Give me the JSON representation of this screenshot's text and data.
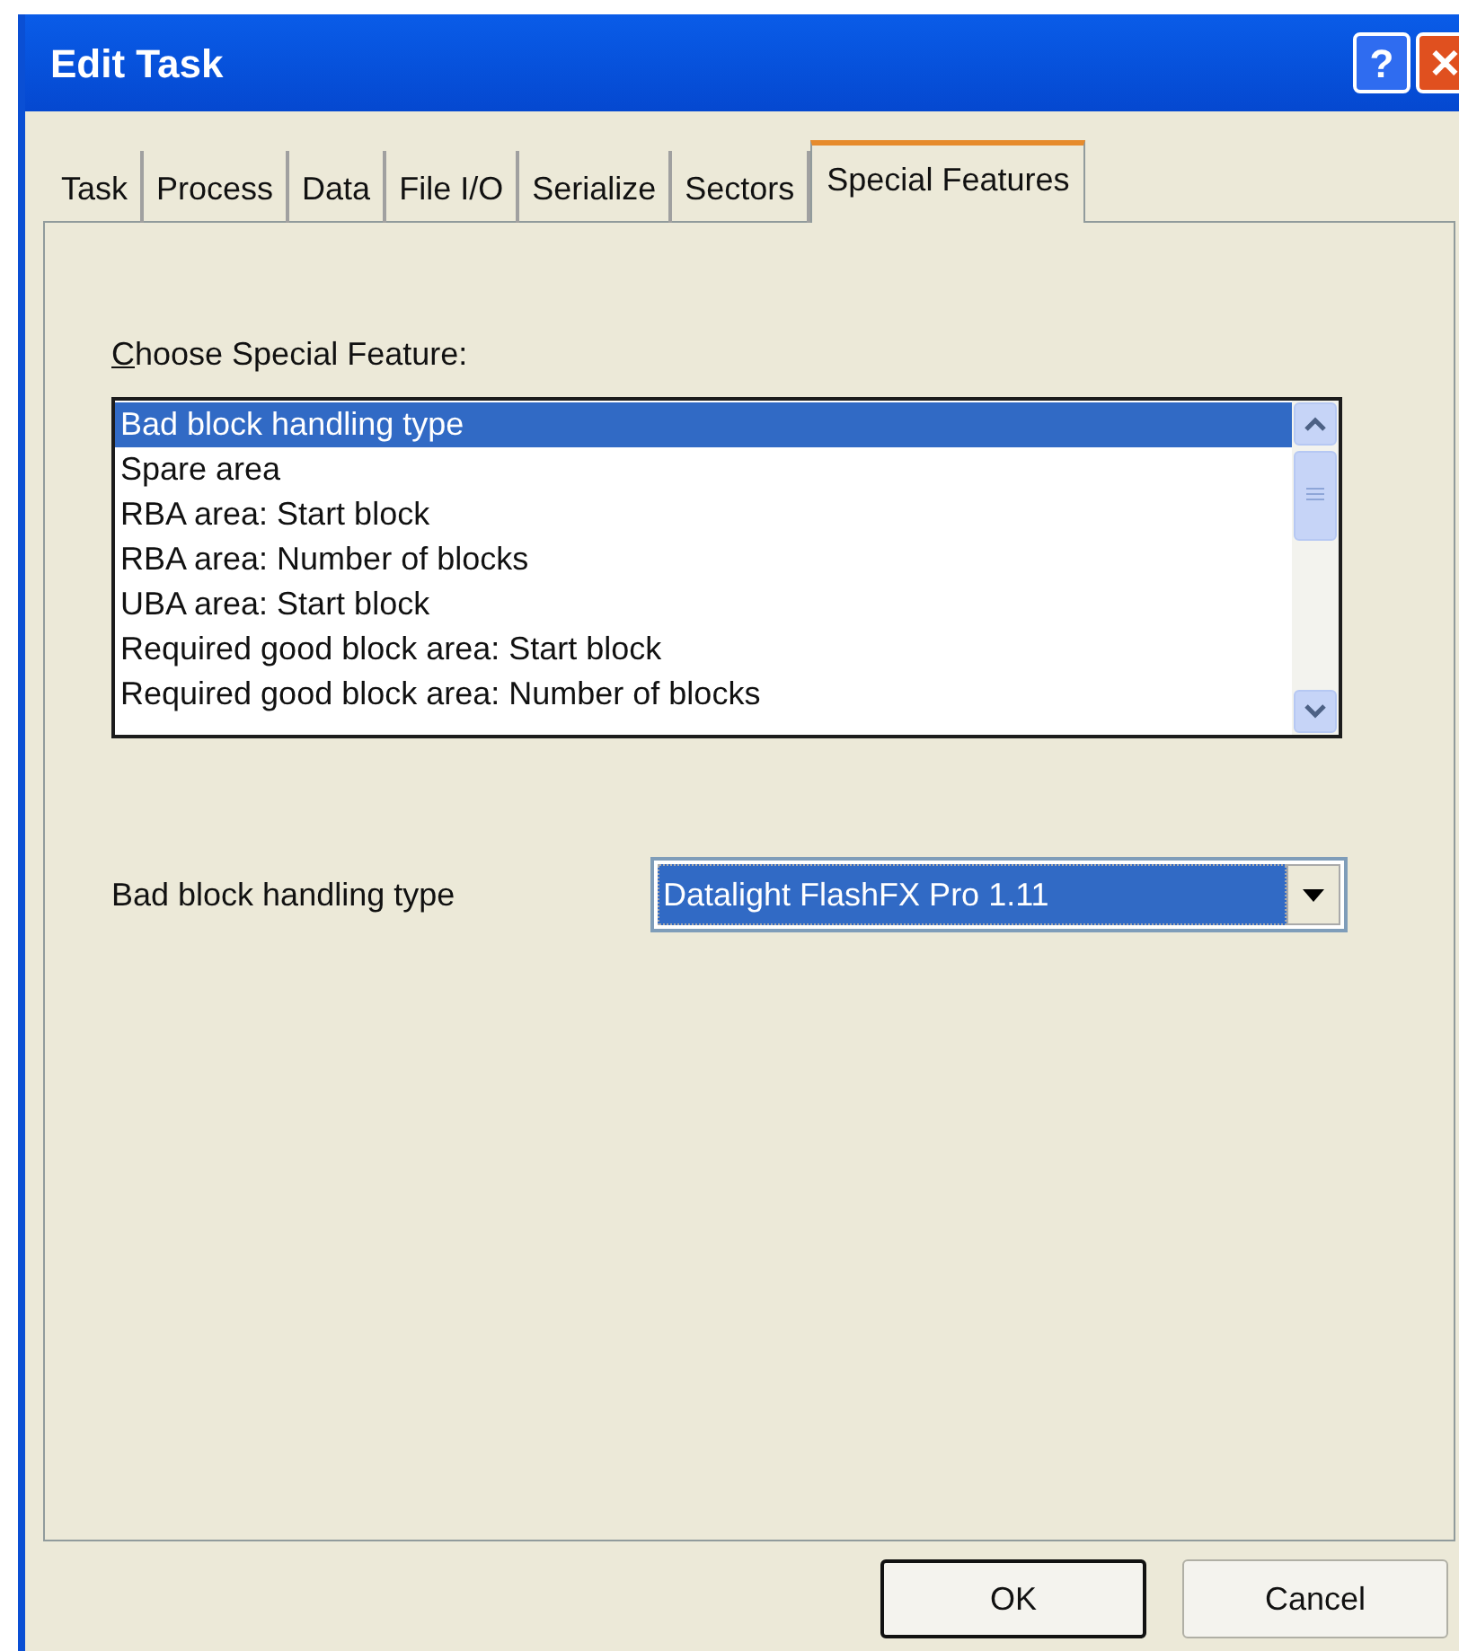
{
  "window": {
    "title": "Edit Task",
    "title_buttons": [
      {
        "kind": "help",
        "label": "?"
      },
      {
        "kind": "close",
        "label": "✕"
      }
    ]
  },
  "tabs": [
    {
      "label": "Task",
      "selected": false
    },
    {
      "label": "Process",
      "selected": false
    },
    {
      "label": "Data",
      "selected": false
    },
    {
      "label": "File I/O",
      "selected": false
    },
    {
      "label": "Serialize",
      "selected": false
    },
    {
      "label": "Sectors",
      "selected": false
    },
    {
      "label": "Special Features",
      "selected": true
    }
  ],
  "feature_list": {
    "label": "Choose Special Feature:",
    "accelerator_underlined": true,
    "items": [
      {
        "label": "Bad block handling type",
        "selected": true
      },
      {
        "label": "Spare area",
        "selected": false
      },
      {
        "label": "RBA area: Start block",
        "selected": false
      },
      {
        "label": "RBA area: Number of blocks",
        "selected": false
      },
      {
        "label": "UBA area: Start block",
        "selected": false
      },
      {
        "label": "Required good block area: Start block",
        "selected": false
      },
      {
        "label": "Required good block area: Number of blocks",
        "selected": false
      }
    ]
  },
  "setting": {
    "label": "Bad block handling type",
    "value": "Datalight FlashFX Pro 1.11"
  },
  "buttons": [
    {
      "label": "OK",
      "default": true
    },
    {
      "label": "Cancel",
      "default": false
    }
  ]
}
